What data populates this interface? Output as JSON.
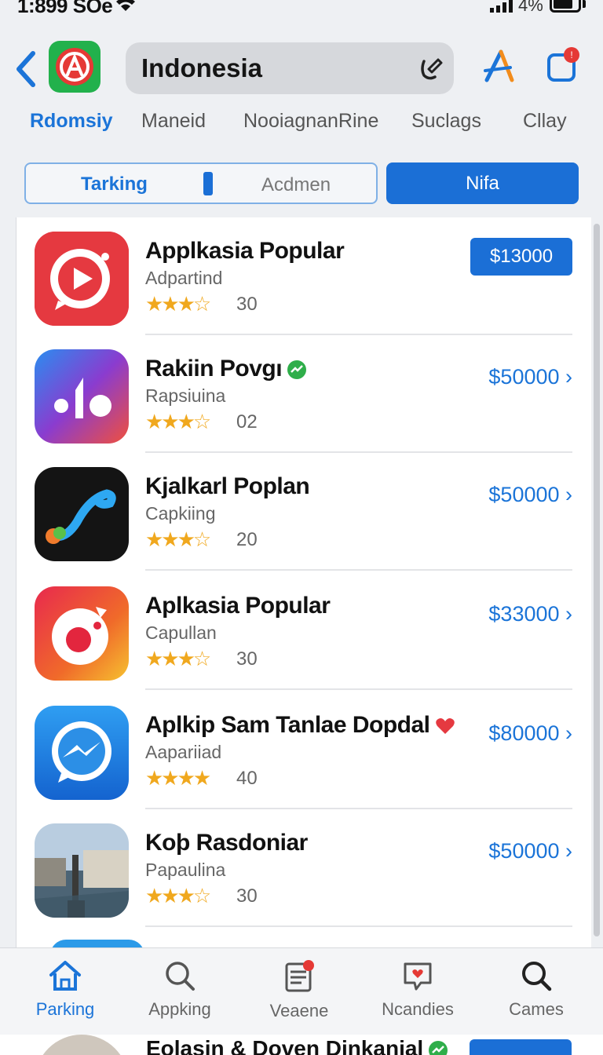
{
  "status_bar": {
    "time": "1:899 SOe",
    "battery": "4%"
  },
  "header": {
    "search_query": "Indonesia"
  },
  "categories": [
    {
      "label": "Rdomsiy",
      "active": true
    },
    {
      "label": "Maneid",
      "active": false
    },
    {
      "label": "NooiagnanRine",
      "active": false
    },
    {
      "label": "Suclags",
      "active": false
    },
    {
      "label": "Cllay",
      "active": false
    }
  ],
  "segments": {
    "left": "Tarking",
    "right": "Acdmen",
    "button": "Nifa"
  },
  "apps": [
    {
      "name": "Applkasia Popular",
      "developer": "Adpartind",
      "stars": "★★★☆",
      "rating_count": "30",
      "price": "$13000",
      "price_style": "button"
    },
    {
      "name": "Rakiin Povgı",
      "developer": "Rapsiuina",
      "stars": "★★★☆",
      "rating_count": "02",
      "price": "$50000 ›",
      "price_style": "link"
    },
    {
      "name": "Kjalkarl Poplan",
      "developer": "Capkiing",
      "stars": "★★★☆",
      "rating_count": "20",
      "price": "$50000 ›",
      "price_style": "link"
    },
    {
      "name": "Aplkasia Popular",
      "developer": "Capullan",
      "stars": "★★★☆",
      "rating_count": "30",
      "price": "$33000 ›",
      "price_style": "link"
    },
    {
      "name": "Aplkip Sam Tanlae Dopdal",
      "developer": "Aapariiad",
      "stars": "★★★★",
      "rating_count": "40",
      "price": "$80000 ›",
      "price_style": "link"
    },
    {
      "name": "Koþ Rasdoniar",
      "developer": "Papaulina",
      "stars": "★★★☆",
      "rating_count": "30",
      "price": "$50000 ›",
      "price_style": "link"
    }
  ],
  "tabs": [
    {
      "label": "Parking",
      "icon": "house-icon",
      "active": true
    },
    {
      "label": "Appking",
      "icon": "search-icon",
      "active": false
    },
    {
      "label": "Veaene",
      "icon": "news-icon",
      "active": false
    },
    {
      "label": "Ncandies",
      "icon": "heart-card-icon",
      "active": false
    },
    {
      "label": "Cames",
      "icon": "search-icon",
      "active": false
    }
  ],
  "peek_row": {
    "title": "Eolasin & Doven Dinkanial"
  },
  "colors": {
    "accent": "#1b74d8",
    "star": "#f0a81e",
    "logo_bg": "#22b14c"
  }
}
